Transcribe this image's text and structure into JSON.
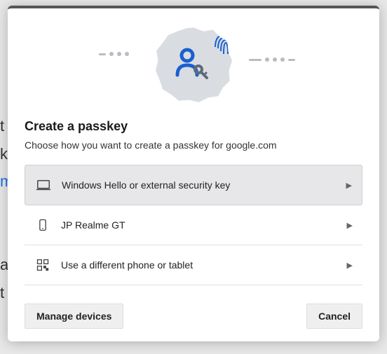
{
  "dialog": {
    "title": "Create a passkey",
    "subtitle": "Choose how you want to create a passkey for google.com",
    "options": [
      {
        "icon": "laptop-icon",
        "label": "Windows Hello or external security key",
        "selected": true
      },
      {
        "icon": "phone-icon",
        "label": "JP Realme GT",
        "selected": false
      },
      {
        "icon": "qr-icon",
        "label": "Use a different phone or tablet",
        "selected": false
      }
    ],
    "buttons": {
      "manage": "Manage devices",
      "cancel": "Cancel"
    }
  }
}
